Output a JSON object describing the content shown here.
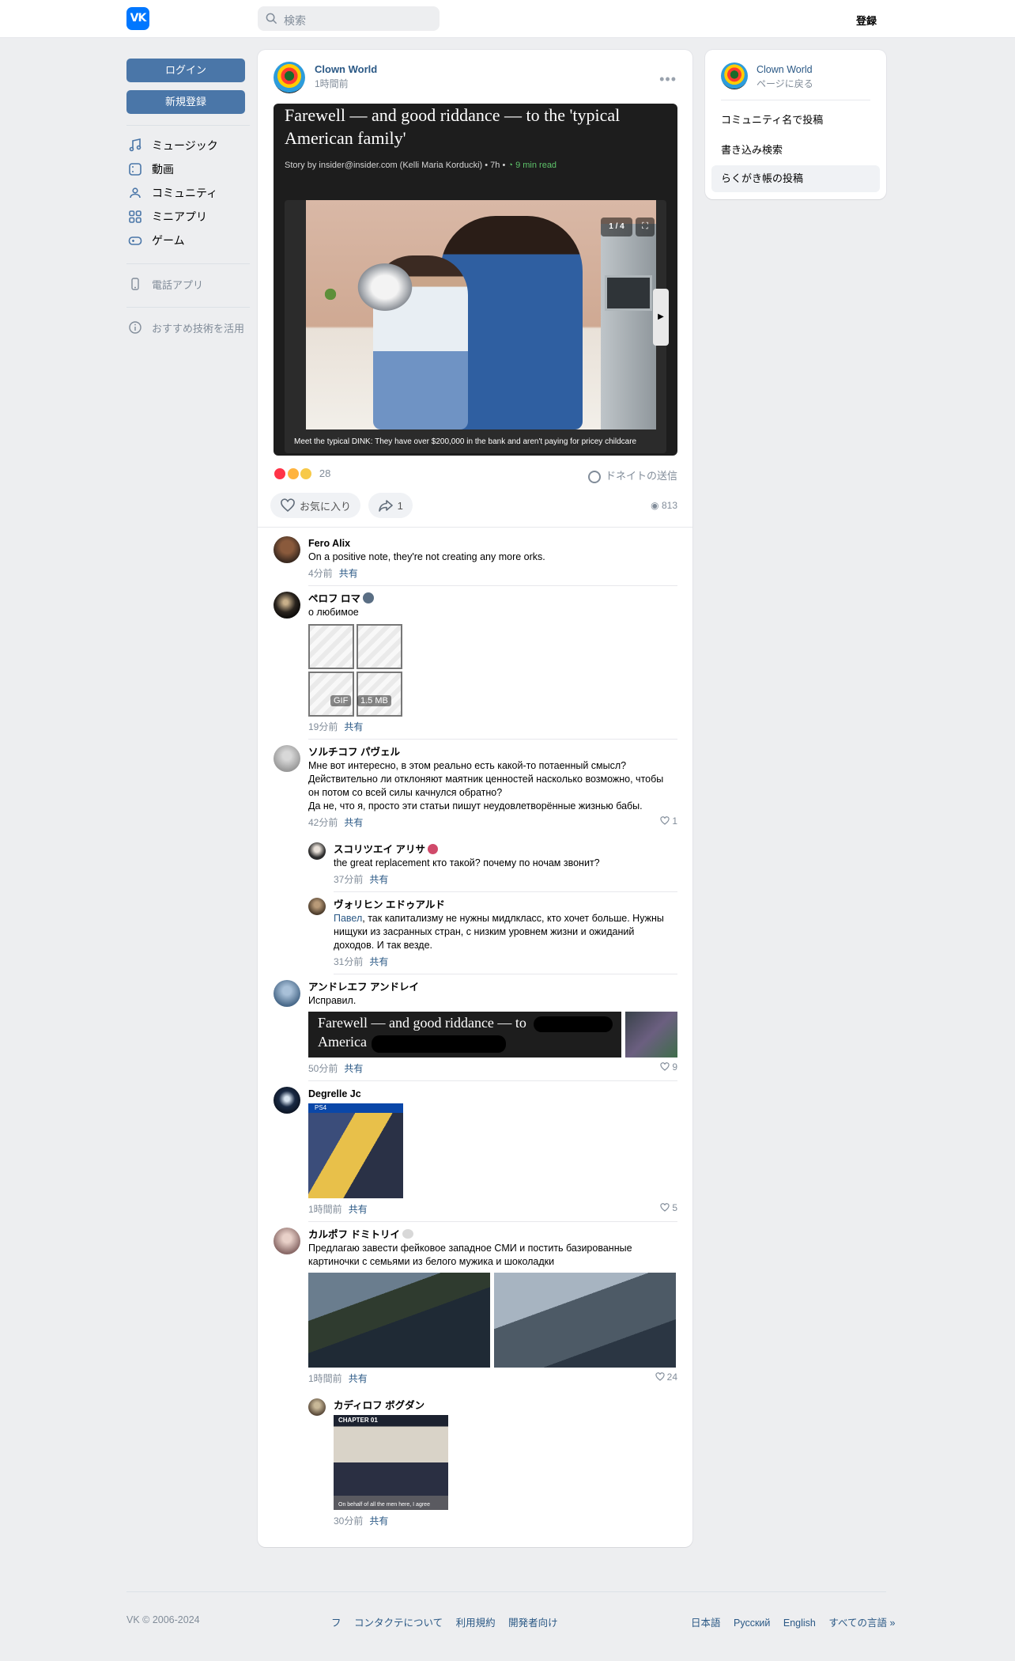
{
  "header": {
    "search_placeholder": "検索",
    "signup": "登録"
  },
  "leftnav": {
    "login": "ログイン",
    "register": "新規登録",
    "items": [
      "ミュージック",
      "動画",
      "コミュニティ",
      "ミニアプリ",
      "ゲーム"
    ],
    "phone_app": "電話アプリ",
    "recommend": "おすすめ技術を活用"
  },
  "post": {
    "author": "Clown World",
    "time": "1時間前",
    "article_title": "Farewell — and good riddance — to the 'typical American family'",
    "story_by": "Story by insider@insider.com (Kelli Maria Korducki) • 7h •",
    "read_time": "9 min read",
    "counter": "1 / 4",
    "caption": "Meet the typical DINK: They have over $200,000 in the bank and aren't paying for pricey childcare",
    "caption_sub": "",
    "reactions_count": "28",
    "donate": "ドネイトの送信",
    "like_label": "お気に入り",
    "share_count": "1",
    "views": "813"
  },
  "comments": [
    {
      "name": "Fero Alix",
      "text": "On a positive note, they're not creating any more orks.",
      "time": "4分前",
      "share": "共有"
    },
    {
      "name": "ペロフ ロマ",
      "text": "о любимое",
      "gif": "GIF",
      "size": "1.5 MB",
      "time": "19分前",
      "share": "共有"
    },
    {
      "name": "ソルチコフ パヴェル",
      "lines": [
        "Мне вот интересно, в этом реально есть какой-то потаенный смысл?",
        "Действительно ли отклоняют маятник ценностей насколько возможно, чтобы",
        "он потом со всей силы качнулся обратно?",
        "Да не, что я, просто эти статьи пишут неудовлетворённые жизнью бабы."
      ],
      "time": "42分前",
      "share": "共有",
      "likes": "1"
    },
    {
      "name": "スコリツエイ アリサ",
      "text": "the great replacement кто такой? почему по ночам звонит?",
      "time": "37分前",
      "share": "共有"
    },
    {
      "name": "ヴォリヒン エドゥアルド",
      "mention": "Павел",
      "lines": [
        ", так капитализму не нужны мидлкласс, кто хочет больше. Нужны",
        "нищуки из засранных стран, с низким уровнем жизни и ожиданий",
        "доходов. И так везде."
      ],
      "time": "31分前",
      "share": "共有"
    },
    {
      "name": "アンドレエフ アンドレイ",
      "text": "Исправил.",
      "att_title_1": "Farewell — and good riddance — to",
      "att_title_2": "America",
      "time": "50分前",
      "share": "共有",
      "likes": "9"
    },
    {
      "name": "Degrelle Jc",
      "poster_tag": "PS4",
      "time": "1時間前",
      "share": "共有",
      "likes": "5"
    },
    {
      "name": "カルポフ ドミトリイ",
      "lines": [
        "Предлагаю завести фейковое западное СМИ и постить базированные",
        "картиночки с семьями из белого мужика и шоколадки"
      ],
      "time": "1時間前",
      "share": "共有",
      "likes": "24"
    },
    {
      "name": "カディロフ ボグダン",
      "chapter": "CHAPTER 01",
      "manga_cap": "On behalf of all the men here, I agree",
      "time": "30分前",
      "share": "共有"
    }
  ],
  "rpanel": {
    "name": "Clown World",
    "back": "ページに戻る",
    "items": [
      "コミュニティ名で投稿",
      "書き込み検索",
      "らくがき帳の投稿"
    ]
  },
  "footer": {
    "copy": "VK © 2006-2024",
    "links": [
      "フ",
      "コンタクテについて",
      "利用規約",
      "開発者向け"
    ],
    "langs": [
      "日本語",
      "Русский",
      "English",
      "すべての言語 »"
    ]
  },
  "colors": {
    "vk_blue": "#0077ff",
    "button_blue": "#4a76a8",
    "link": "#2a5885",
    "muted": "#818c99"
  }
}
